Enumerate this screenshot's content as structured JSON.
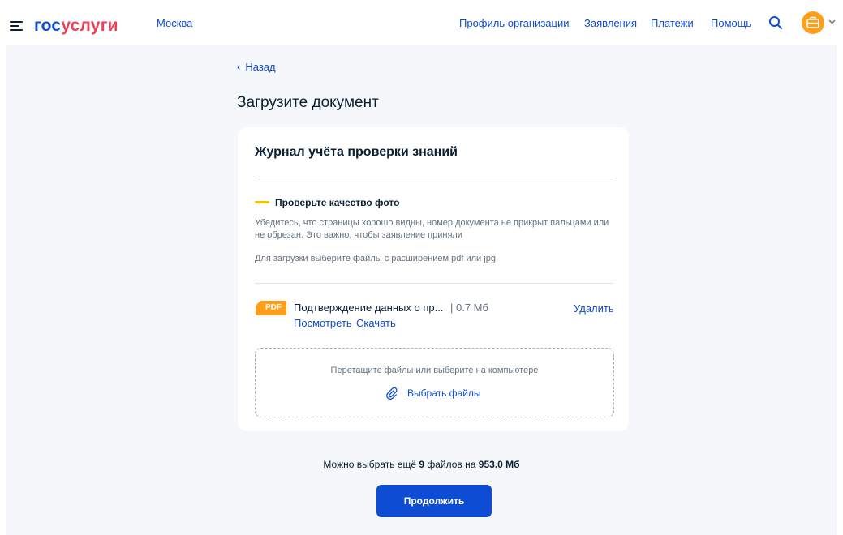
{
  "header": {
    "logo_part1": "гос",
    "logo_part2": "услуги",
    "city": "Москва",
    "nav": [
      "Профиль организации",
      "Заявления",
      "Платежи",
      "Помощь"
    ],
    "icons": [
      "menu-icon",
      "search-icon",
      "avatar-briefcase-icon",
      "chevron-down-icon"
    ]
  },
  "back_label": "Назад",
  "page_title": "Загрузите документ",
  "card": {
    "title": "Журнал учёта проверки знаний",
    "warning_title": "Проверьте качество фото",
    "warning_text": "Убедитесь, что страницы хорошо видны, номер документа не прикрыт пальцами или не обрезан. Это важно, чтобы заявление приняли",
    "extensions_text": "Для загрузки выберите файлы с расширением pdf или jpg",
    "file": {
      "badge": "PDF",
      "name": "Подтверждение данных о пр...",
      "size": "| 0.7 Мб",
      "delete": "Удалить",
      "view": "Посмотреть",
      "download": "Скачать"
    },
    "dropzone_hint": "Перетащите файлы или выберите на компьютере",
    "pick_files": "Выбрать файлы"
  },
  "limit": {
    "prefix": "Можно выбрать ещё",
    "count": "9",
    "middle": "файлов на",
    "size": "953.0 Мб"
  },
  "continue_label": "Продолжить",
  "colors": {
    "brand_blue": "#0d4cd3",
    "brand_red": "#ee3f58",
    "warning_yellow": "#f5c400",
    "pdf_orange": "#ff9e1b",
    "avatar_orange": "#ff9e1b",
    "page_bg": "#f5f7fa"
  }
}
